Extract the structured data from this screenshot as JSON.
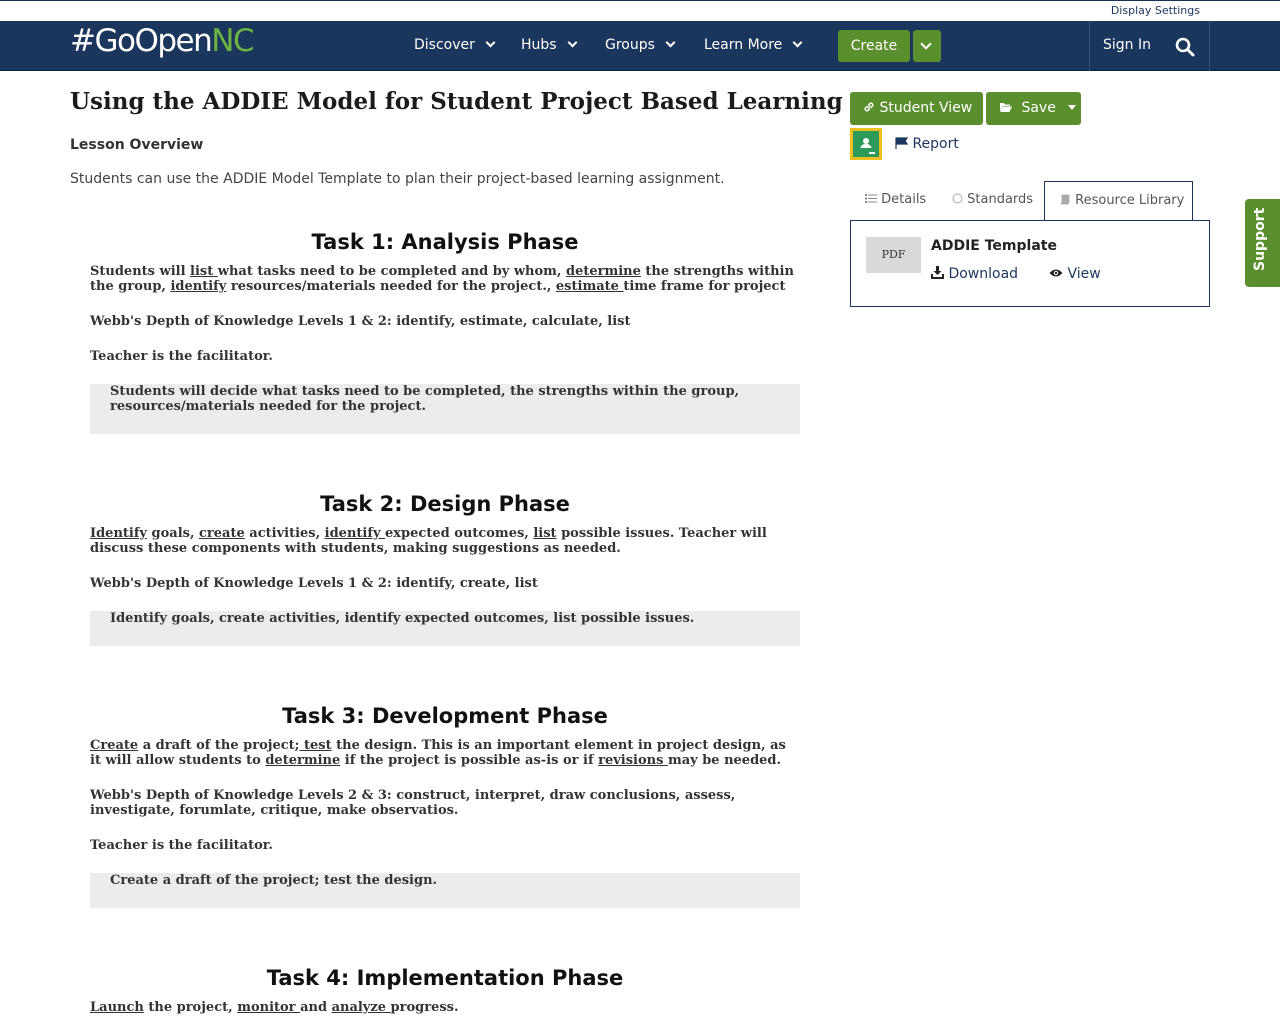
{
  "util": {
    "display_settings": "Display Settings"
  },
  "nav": {
    "logo_hash": "#GoOpen",
    "logo_nc": "NC",
    "items": [
      {
        "label": "Discover"
      },
      {
        "label": "Hubs"
      },
      {
        "label": "Groups"
      },
      {
        "label": "Learn More"
      }
    ],
    "create_label": "Create",
    "sign_in": "Sign In"
  },
  "main": {
    "title": "Using the ADDIE Model for Student Project Based Learning",
    "overview_heading": "Lesson Overview",
    "overview_text": "Students can use the ADDIE Model Template to plan their project-based learning assignment."
  },
  "tasks": {
    "t1": {
      "title": "Task 1: Analysis Phase",
      "p1": [
        {
          "text": "Students will ",
          "u": false
        },
        {
          "text": "list ",
          "u": true
        },
        {
          "text": "what tasks need to be completed and by whom, ",
          "u": false
        },
        {
          "text": "determine",
          "u": true
        },
        {
          "text": " the strengths within the group, ",
          "u": false
        },
        {
          "text": "identify",
          "u": true
        },
        {
          "text": " resources/materials needed for the project., ",
          "u": false
        },
        {
          "text": "estimate ",
          "u": true
        },
        {
          "text": "time frame for project",
          "u": false
        }
      ],
      "dok": "Webb's Depth of Knowledge Levels 1 & 2: identify, estimate, calculate, list",
      "facilitator": "Teacher is the facilitator.",
      "box": "Students will decide what tasks need to be completed, the strengths within the group, resources/materials needed for the project."
    },
    "t2": {
      "title": "Task 2: Design Phase",
      "p1": [
        {
          "text": "Identify",
          "u": true
        },
        {
          "text": " goals, ",
          "u": false
        },
        {
          "text": "create",
          "u": true
        },
        {
          "text": " activities, ",
          "u": false
        },
        {
          "text": "identify ",
          "u": true
        },
        {
          "text": "expected outcomes, ",
          "u": false
        },
        {
          "text": "list",
          "u": true
        },
        {
          "text": " possible issues. Teacher will discuss these components with students, making suggestions as needed.",
          "u": false
        }
      ],
      "dok": "Webb's Depth of Knowledge Levels 1 & 2: identify, create, list",
      "box": "Identify goals, create activities, identify expected outcomes, list possible issues."
    },
    "t3": {
      "title": "Task 3: Development Phase",
      "p1": [
        {
          "text": "Create",
          "u": true
        },
        {
          "text": " a draft of the project;",
          "u": false
        },
        {
          "text": " test",
          "u": true
        },
        {
          "text": " the design. This is an important element in project design, as it will allow students to ",
          "u": false
        },
        {
          "text": "determine",
          "u": true
        },
        {
          "text": " if the project is possible as-is or if ",
          "u": false
        },
        {
          "text": "revisions ",
          "u": true
        },
        {
          "text": "may be needed.",
          "u": false
        }
      ],
      "dok": "Webb's Depth of Knowledge Levels 2 & 3: construct, interpret, draw conclusions, assess, investigate, forumlate, critique, make observatios.",
      "facilitator": "Teacher is the facilitator.",
      "box": "Create a draft of the project; test the design."
    },
    "t4": {
      "title": "Task 4: Implementation Phase",
      "p1": [
        {
          "text": "Launch",
          "u": true
        },
        {
          "text": " the project, ",
          "u": false
        },
        {
          "text": "monitor ",
          "u": true
        },
        {
          "text": "and ",
          "u": false
        },
        {
          "text": "analyze ",
          "u": true
        },
        {
          "text": "progress.",
          "u": false
        }
      ]
    }
  },
  "side": {
    "student_view": "Student View",
    "save": "Save",
    "report": "Report",
    "tabs": {
      "details": "Details",
      "standards": "Standards",
      "library": "Resource Library"
    },
    "resource": {
      "type": "PDF",
      "title": "ADDIE Template",
      "download": "Download",
      "view": "View"
    },
    "support": "Support"
  },
  "colors": {
    "navy": "#1b365d",
    "green": "#5a8f2e",
    "logo_green": "#6db33f",
    "gray_box": "#ececec"
  }
}
